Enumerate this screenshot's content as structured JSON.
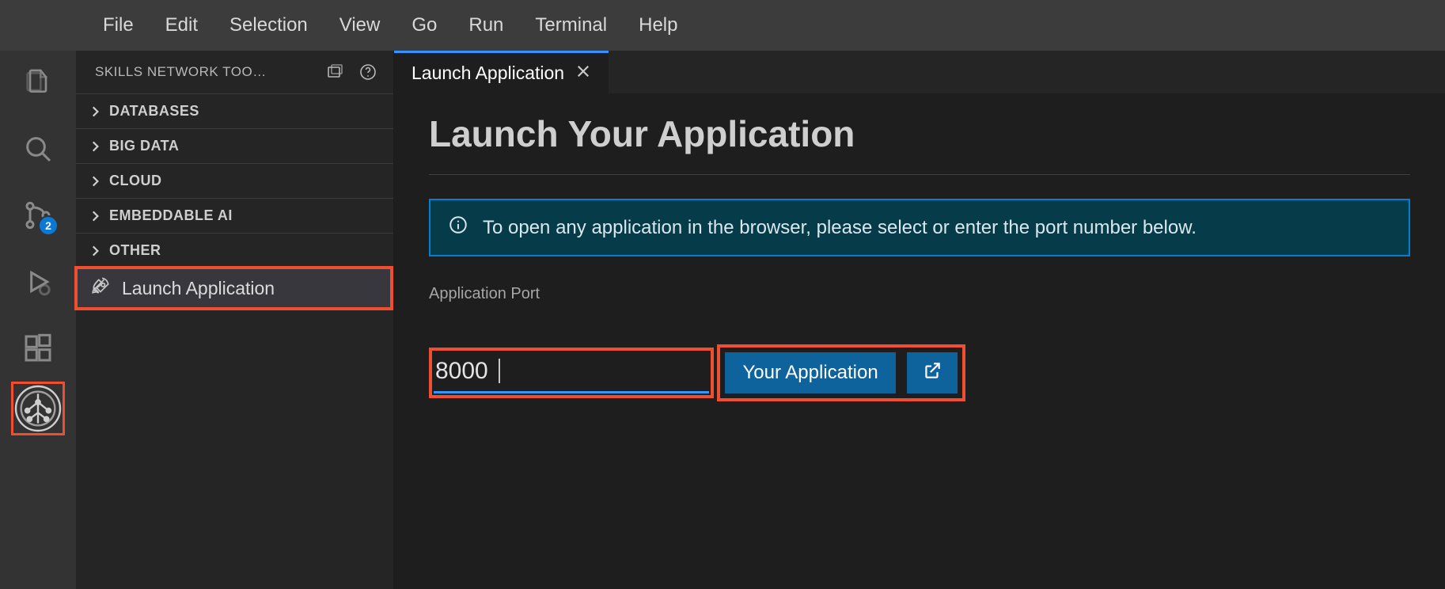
{
  "menu": {
    "file": "File",
    "edit": "Edit",
    "selection": "Selection",
    "view": "View",
    "go": "Go",
    "run": "Run",
    "terminal": "Terminal",
    "help": "Help"
  },
  "activitybar": {
    "scm_badge": "2"
  },
  "sidebar": {
    "title": "SKILLS NETWORK TOO…",
    "sections": {
      "databases": "DATABASES",
      "bigdata": "BIG DATA",
      "cloud": "CLOUD",
      "embeddable_ai": "EMBEDDABLE AI",
      "other": "OTHER"
    },
    "launch_leaf": "Launch Application"
  },
  "tabs": {
    "launch": "Launch Application"
  },
  "main": {
    "heading": "Launch Your Application",
    "banner": "To open any application in the browser, please select or enter the port number below.",
    "port_label": "Application Port",
    "port_value": "8000",
    "your_app_btn": "Your Application"
  }
}
